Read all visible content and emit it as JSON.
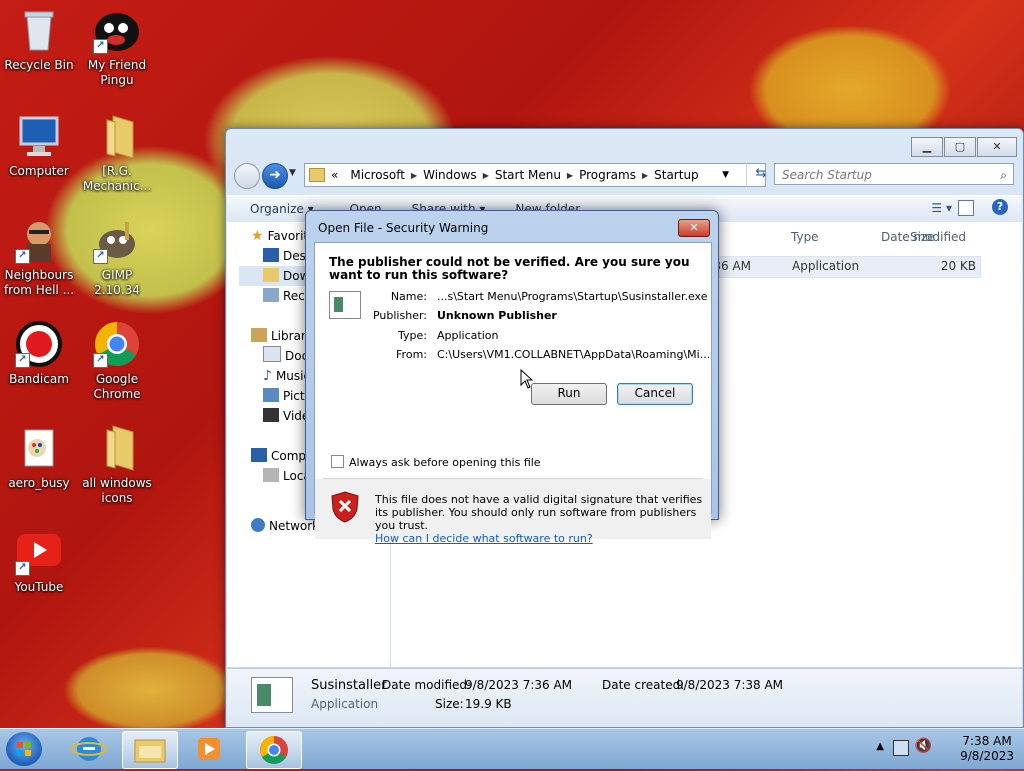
{
  "desktop": {
    "icons": [
      {
        "label": "Recycle Bin"
      },
      {
        "label": "My Friend Pingu"
      },
      {
        "label": "Computer"
      },
      {
        "label": "[R.G. Mechanic..."
      },
      {
        "label": "Neighbours from Hell ..."
      },
      {
        "label": "GIMP 2.10.34"
      },
      {
        "label": "Bandicam"
      },
      {
        "label": "Google Chrome"
      },
      {
        "label": "aero_busy"
      },
      {
        "label": "all windows icons"
      },
      {
        "label": "YouTube"
      }
    ]
  },
  "explorer": {
    "address": {
      "overflow": "«",
      "crumbs": [
        "Microsoft",
        "Windows",
        "Start Menu",
        "Programs",
        "Startup"
      ]
    },
    "search_placeholder": "Search Startup",
    "toolbar": {
      "organize": "Organize ▾",
      "open": "Open",
      "share_with": "Share with ▾",
      "new_folder": "New folder"
    },
    "nav": {
      "favorites": "Favorites",
      "desktop": "Desktop",
      "downloads": "Downloads",
      "recent": "Recent Places",
      "libraries": "Libraries",
      "documents": "Documents",
      "music": "Music",
      "pictures": "Pictures",
      "videos": "Videos",
      "computer": "Computer",
      "local_disk": "Local Disk (C:)",
      "network": "Network"
    },
    "columns": {
      "modified": "Date modified",
      "type": "Type",
      "size": "Size"
    },
    "file_row": {
      "modified": "9/8/2023 7:36 AM",
      "type": "Application",
      "size": "20 KB"
    },
    "details": {
      "name": "Susinstaller",
      "kind": "Application",
      "date_modified_label": "Date modified:",
      "date_modified": "9/8/2023 7:36 AM",
      "date_created_label": "Date created:",
      "date_created": "9/8/2023 7:38 AM",
      "size_label": "Size:",
      "size": "19.9 KB"
    }
  },
  "dialog": {
    "title": "Open File - Security Warning",
    "question": "The publisher could not be verified.  Are you sure you want to run this software?",
    "fields": {
      "name_label": "Name:",
      "name": "...s\\Start Menu\\Programs\\Startup\\Susinstaller.exe",
      "publisher_label": "Publisher:",
      "publisher": "Unknown Publisher",
      "type_label": "Type:",
      "type": "Application",
      "from_label": "From:",
      "from": "C:\\Users\\VM1.COLLABNET\\AppData\\Roaming\\Mi..."
    },
    "run": "Run",
    "cancel": "Cancel",
    "checkbox": "Always ask before opening this file",
    "warning": "This file does not have a valid digital signature that verifies its publisher.  You should only run software from publishers you trust.",
    "link": "How can I decide what software to run?"
  },
  "taskbar": {
    "time": "7:38 AM",
    "date": "9/8/2023"
  }
}
